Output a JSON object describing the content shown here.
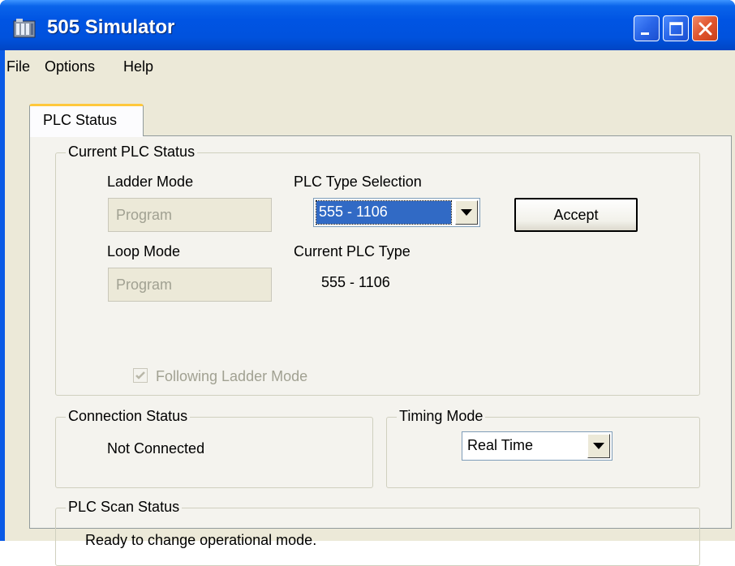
{
  "window": {
    "title": "505 Simulator",
    "icon": "plc-app-icon"
  },
  "menu": [
    "File",
    "Options",
    "Help"
  ],
  "tabs": [
    {
      "label": "PLC Status",
      "selected": true
    }
  ],
  "current_plc_status": {
    "group_label": "Current PLC Status",
    "ladder_mode_label": "Ladder Mode",
    "ladder_mode_value": "Program",
    "loop_mode_label": "Loop Mode",
    "loop_mode_value": "Program",
    "plc_type_selection_label": "PLC Type Selection",
    "plc_type_selection_value": "555 - 1106",
    "accept_label": "Accept",
    "current_plc_type_label": "Current PLC Type",
    "current_plc_type_value": "555 - 1106",
    "following_ladder_label": "Following Ladder Mode",
    "following_ladder_checked": true
  },
  "connection_status": {
    "group_label": "Connection Status",
    "value": "Not Connected"
  },
  "timing_mode": {
    "group_label": "Timing Mode",
    "value": "Real Time"
  },
  "plc_scan_status": {
    "group_label": "PLC Scan Status",
    "value": "Ready to change operational mode."
  },
  "colors": {
    "titlebar": "#0054e3",
    "face": "#ece9d8",
    "panel": "#f4f3ee",
    "selection": "#316ac5",
    "close": "#e1552e"
  }
}
